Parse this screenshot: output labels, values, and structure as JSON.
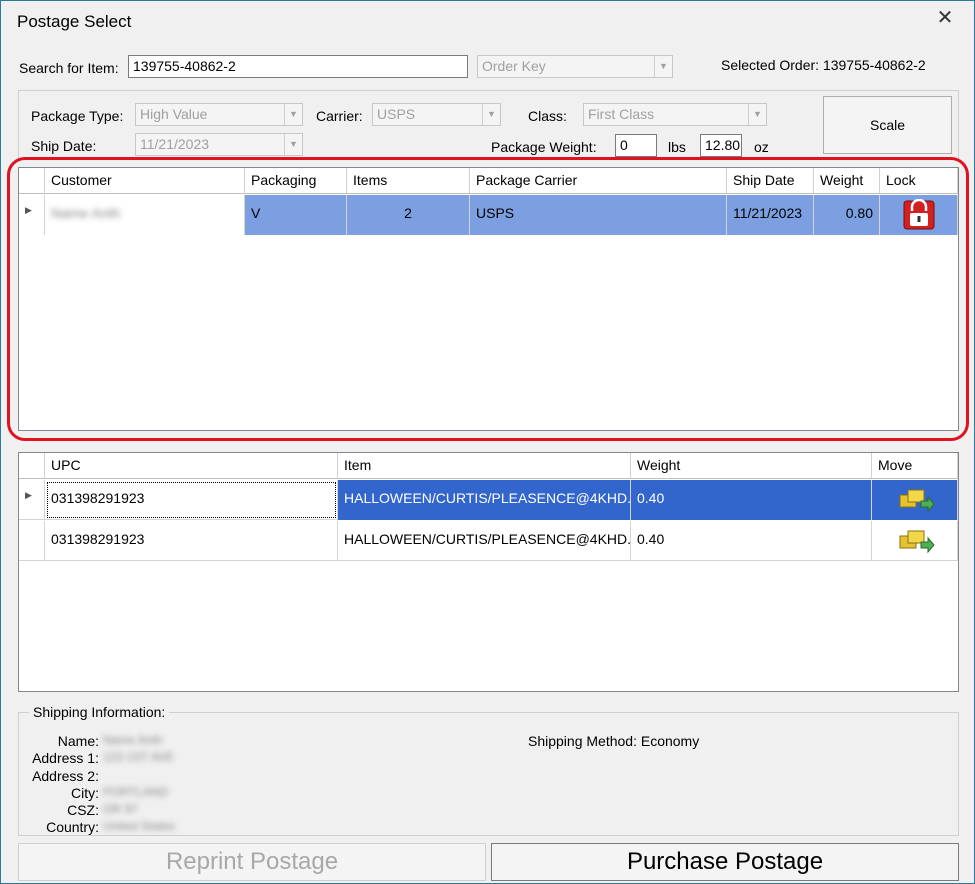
{
  "window": {
    "title": "Postage Select",
    "close": "✕"
  },
  "search": {
    "label": "Search for Item:",
    "value": "139755-40862-2",
    "order_key_placeholder": "Order Key",
    "selected_order": "Selected Order: 139755-40862-2"
  },
  "package": {
    "type_label": "Package Type:",
    "type_value": "High Value",
    "carrier_label": "Carrier:",
    "carrier_value": "USPS",
    "class_label": "Class:",
    "class_value": "First Class",
    "ship_date_label": "Ship Date:",
    "ship_date_value": "11/21/2023",
    "weight_label": "Package Weight:",
    "lbs_value": "0",
    "lbs_unit": "lbs",
    "oz_value": "12.80",
    "oz_unit": "oz",
    "scale_button": "Scale"
  },
  "orders_grid": {
    "headers": [
      "Customer",
      "Packaging",
      "Items",
      "Package Carrier",
      "Ship Date",
      "Weight",
      "Lock"
    ],
    "rows": [
      {
        "customer": "Name Anth",
        "packaging": "V",
        "items": "2",
        "carrier": "USPS",
        "ship_date": "11/21/2023",
        "weight": "0.80",
        "lock_icon": "lock-icon"
      }
    ]
  },
  "items_grid": {
    "headers": [
      "UPC",
      "Item",
      "Weight",
      "Move"
    ],
    "rows": [
      {
        "upc": "031398291923",
        "item": "HALLOWEEN/CURTIS/PLEASENCE@4KHD...",
        "weight": "0.40",
        "move_icon": "move-icon"
      },
      {
        "upc": "031398291923",
        "item": "HALLOWEEN/CURTIS/PLEASENCE@4KHD...",
        "weight": "0.40",
        "move_icon": "move-icon"
      }
    ]
  },
  "shipping": {
    "legend": "Shipping Information:",
    "name_label": "Name:",
    "name_value": "Name Anth",
    "address1_label": "Address 1:",
    "address1_value": "123 1ST AVE",
    "address2_label": "Address 2:",
    "address2_value": "",
    "city_label": "City:",
    "city_value": "PORTLAND",
    "csz_label": "CSZ:",
    "csz_value": "OR 97",
    "country_label": "Country:",
    "country_value": "United States",
    "method": "Shipping Method: Economy"
  },
  "actions": {
    "reprint": "Reprint Postage",
    "purchase": "Purchase Postage"
  },
  "colors": {
    "highlight": "#e0121f",
    "row_selected": "#7b9fe0",
    "row_selected_dark": "#3366cc"
  }
}
